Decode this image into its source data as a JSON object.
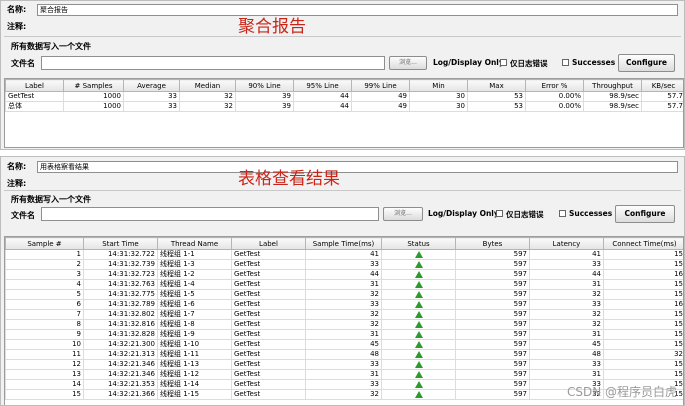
{
  "aggregate": {
    "name_label": "名称:",
    "name_value": "聚合报告",
    "comment_label": "注释:",
    "big_title": "聚合报告",
    "write_all_label": "所有数据写入一个文件",
    "filename_label": "文件名",
    "filename_value": "",
    "browse_label": "浏览...",
    "log_display_label": "Log/Display Only:",
    "errors_label": "仅日志错误",
    "successes_label": "Successes",
    "configure_label": "Configure",
    "columns": [
      "Label",
      "# Samples",
      "Average",
      "Median",
      "90% Line",
      "95% Line",
      "99% Line",
      "Min",
      "Max",
      "Error %",
      "Throughput",
      "KB/sec"
    ],
    "rows": [
      [
        "GetTest",
        "1000",
        "33",
        "32",
        "39",
        "44",
        "49",
        "30",
        "53",
        "0.00%",
        "98.9/sec",
        "57.7"
      ],
      [
        "总体",
        "1000",
        "33",
        "32",
        "39",
        "44",
        "49",
        "30",
        "53",
        "0.00%",
        "98.9/sec",
        "57.7"
      ]
    ]
  },
  "table_view": {
    "name_label": "名称:",
    "name_value": "用表格察看结果",
    "comment_label": "注释:",
    "big_title": "表格查看结果",
    "write_all_label": "所有数据写入一个文件",
    "filename_label": "文件名",
    "filename_value": "",
    "browse_label": "浏览...",
    "log_display_label": "Log/Display Only:",
    "errors_label": "仅日志错误",
    "successes_label": "Successes",
    "configure_label": "Configure",
    "columns": [
      "Sample #",
      "Start Time",
      "Thread Name",
      "Label",
      "Sample Time(ms)",
      "Status",
      "Bytes",
      "Latency",
      "Connect Time(ms)"
    ],
    "rows": [
      [
        "1",
        "14:31:32.722",
        "线程组 1-1",
        "GetTest",
        "41",
        "success",
        "597",
        "41",
        "15"
      ],
      [
        "2",
        "14:31:32.739",
        "线程组 1-3",
        "GetTest",
        "33",
        "success",
        "597",
        "33",
        "15"
      ],
      [
        "3",
        "14:31:32.723",
        "线程组 1-2",
        "GetTest",
        "44",
        "success",
        "597",
        "44",
        "16"
      ],
      [
        "4",
        "14:31:32.763",
        "线程组 1-4",
        "GetTest",
        "31",
        "success",
        "597",
        "31",
        "15"
      ],
      [
        "5",
        "14:31:32.775",
        "线程组 1-5",
        "GetTest",
        "32",
        "success",
        "597",
        "32",
        "15"
      ],
      [
        "6",
        "14:31:32.789",
        "线程组 1-6",
        "GetTest",
        "33",
        "success",
        "597",
        "33",
        "16"
      ],
      [
        "7",
        "14:31:32.802",
        "线程组 1-7",
        "GetTest",
        "32",
        "success",
        "597",
        "32",
        "15"
      ],
      [
        "8",
        "14:31:32.816",
        "线程组 1-8",
        "GetTest",
        "32",
        "success",
        "597",
        "32",
        "15"
      ],
      [
        "9",
        "14:31:32.828",
        "线程组 1-9",
        "GetTest",
        "31",
        "success",
        "597",
        "31",
        "15"
      ],
      [
        "10",
        "14:32:21.300",
        "线程组 1-10",
        "GetTest",
        "45",
        "success",
        "597",
        "45",
        "15"
      ],
      [
        "11",
        "14:32:21.313",
        "线程组 1-11",
        "GetTest",
        "48",
        "success",
        "597",
        "48",
        "32"
      ],
      [
        "12",
        "14:32:21.346",
        "线程组 1-13",
        "GetTest",
        "33",
        "success",
        "597",
        "33",
        "15"
      ],
      [
        "13",
        "14:32:21.346",
        "线程组 1-12",
        "GetTest",
        "31",
        "success",
        "597",
        "31",
        "15"
      ],
      [
        "14",
        "14:32:21.353",
        "线程组 1-14",
        "GetTest",
        "33",
        "success",
        "597",
        "33",
        "15"
      ],
      [
        "15",
        "14:32:21.366",
        "线程组 1-15",
        "GetTest",
        "32",
        "success",
        "597",
        "32",
        "15"
      ]
    ]
  },
  "watermark": "CSDN @程序员白虎",
  "colors": {
    "title_red": "#c9261a",
    "success_green": "#2e9a2e"
  }
}
